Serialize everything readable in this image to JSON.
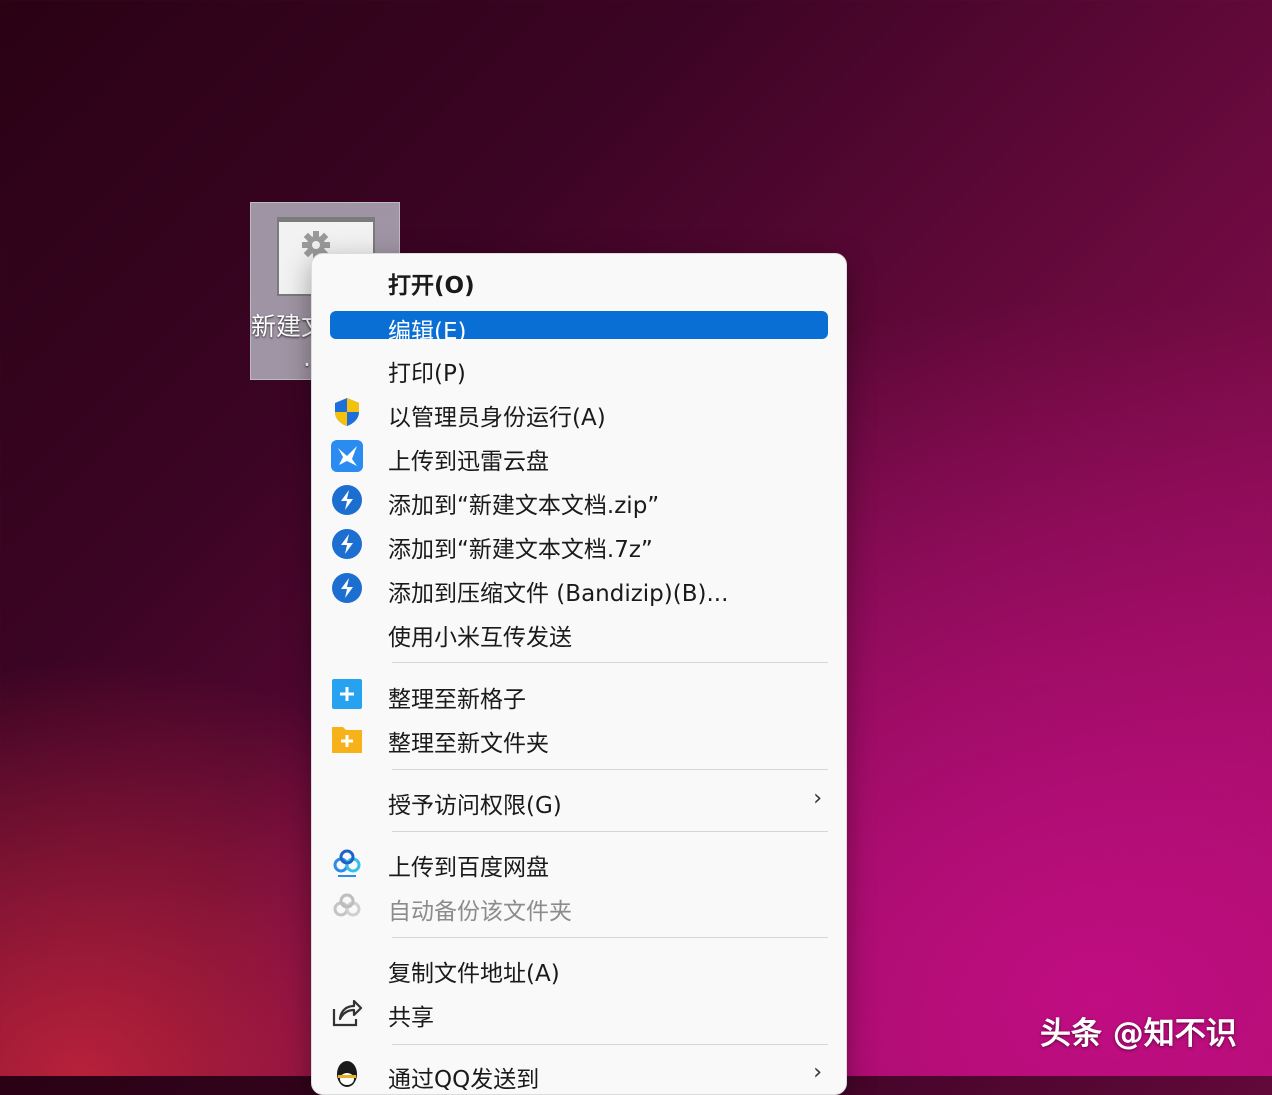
{
  "desktop": {
    "file": {
      "label_line1": "新建文",
      "label_line2": "."
    }
  },
  "menu": {
    "items": [
      {
        "label": "打开(O)"
      },
      {
        "label": "编辑(E)"
      },
      {
        "label": "打印(P)"
      },
      {
        "label": "以管理员身份运行(A)",
        "icon": "uac-shield-icon"
      },
      {
        "label": "上传到迅雷云盘",
        "icon": "xunlei-icon"
      },
      {
        "label": "添加到“新建文本文档.zip”",
        "icon": "bandizip-icon"
      },
      {
        "label": "添加到“新建文本文档.7z”",
        "icon": "bandizip-icon"
      },
      {
        "label": "添加到压缩文件 (Bandizip)(B)...",
        "icon": "bandizip-icon"
      },
      {
        "label": "使用小米互传发送"
      },
      {
        "label": "整理至新格子",
        "icon": "fences-icon"
      },
      {
        "label": "整理至新文件夹",
        "icon": "folder-plus-icon"
      },
      {
        "label": "授予访问权限(G)",
        "submenu": "›"
      },
      {
        "label": "上传到百度网盘",
        "icon": "baidu-netdisk-icon"
      },
      {
        "label": "自动备份该文件夹",
        "icon": "baidu-netdisk-icon",
        "disabled": true
      },
      {
        "label": "复制文件地址(A)"
      },
      {
        "label": "共享",
        "icon": "share-icon"
      },
      {
        "label": "通过QQ发送到",
        "icon": "qq-icon",
        "submenu": "›"
      }
    ]
  },
  "colors": {
    "selection": "#0a6fd4",
    "menu_bg": "#f9f9f9"
  },
  "watermark": "头条 @知不识"
}
